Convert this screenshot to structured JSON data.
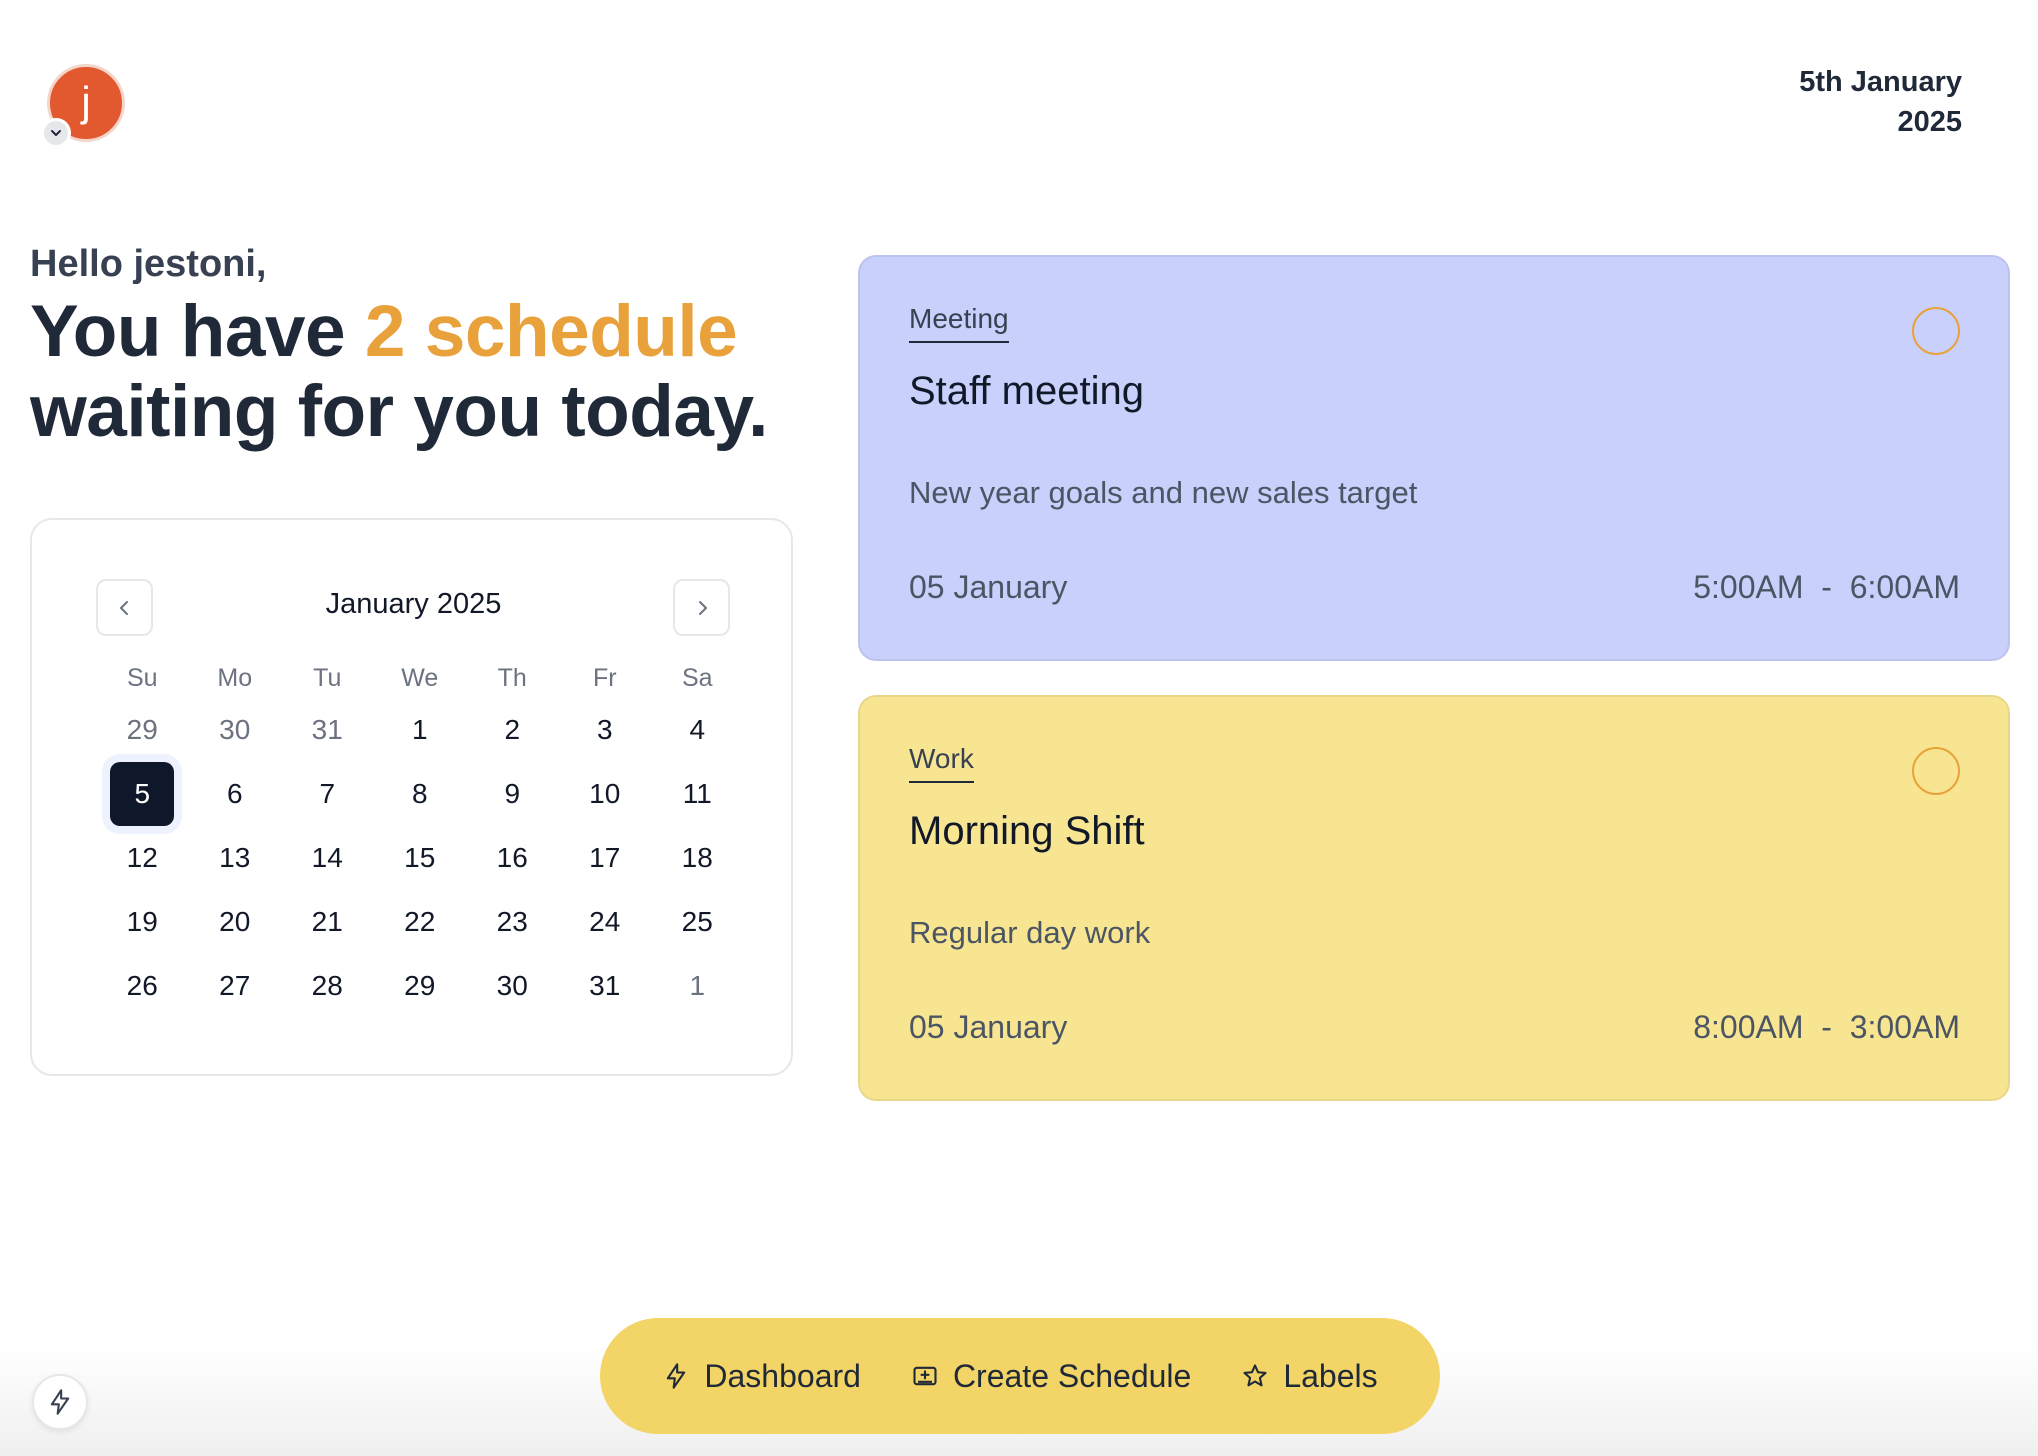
{
  "user": {
    "avatar_initial": "j"
  },
  "header": {
    "date_line1": "5th January",
    "date_line2": "2025"
  },
  "greeting": {
    "hello": "Hello jestoni,",
    "headline_before": "You have ",
    "headline_accent": "2 schedule",
    "headline_after": "waiting for you today."
  },
  "calendar": {
    "title": "January 2025",
    "weekdays": [
      "Su",
      "Mo",
      "Tu",
      "We",
      "Th",
      "Fr",
      "Sa"
    ],
    "weeks": [
      [
        {
          "d": "29",
          "muted": true
        },
        {
          "d": "30",
          "muted": true
        },
        {
          "d": "31",
          "muted": true
        },
        {
          "d": "1"
        },
        {
          "d": "2"
        },
        {
          "d": "3"
        },
        {
          "d": "4"
        }
      ],
      [
        {
          "d": "5",
          "selected": true
        },
        {
          "d": "6"
        },
        {
          "d": "7"
        },
        {
          "d": "8"
        },
        {
          "d": "9"
        },
        {
          "d": "10"
        },
        {
          "d": "11"
        }
      ],
      [
        {
          "d": "12"
        },
        {
          "d": "13"
        },
        {
          "d": "14"
        },
        {
          "d": "15"
        },
        {
          "d": "16"
        },
        {
          "d": "17"
        },
        {
          "d": "18"
        }
      ],
      [
        {
          "d": "19"
        },
        {
          "d": "20"
        },
        {
          "d": "21"
        },
        {
          "d": "22"
        },
        {
          "d": "23"
        },
        {
          "d": "24"
        },
        {
          "d": "25"
        }
      ],
      [
        {
          "d": "26"
        },
        {
          "d": "27"
        },
        {
          "d": "28"
        },
        {
          "d": "29"
        },
        {
          "d": "30"
        },
        {
          "d": "31"
        },
        {
          "d": "1",
          "muted": true
        }
      ]
    ]
  },
  "schedules": [
    {
      "label": "Meeting",
      "title": "Staff meeting",
      "description": "New year goals and new sales target",
      "date": "05 January",
      "time": "5:00AM  -  6:00AM",
      "color": "#c8d0fb"
    },
    {
      "label": "Work",
      "title": "Morning Shift",
      "description": "Regular day work",
      "date": "05 January",
      "time": "8:00AM  -  3:00AM",
      "color": "#f8e592"
    }
  ],
  "nav": {
    "dashboard": "Dashboard",
    "create_schedule": "Create Schedule",
    "labels": "Labels"
  },
  "colors": {
    "accent": "#e9a23b",
    "avatar": "#e2592f",
    "nav_bg": "#f3d466"
  }
}
